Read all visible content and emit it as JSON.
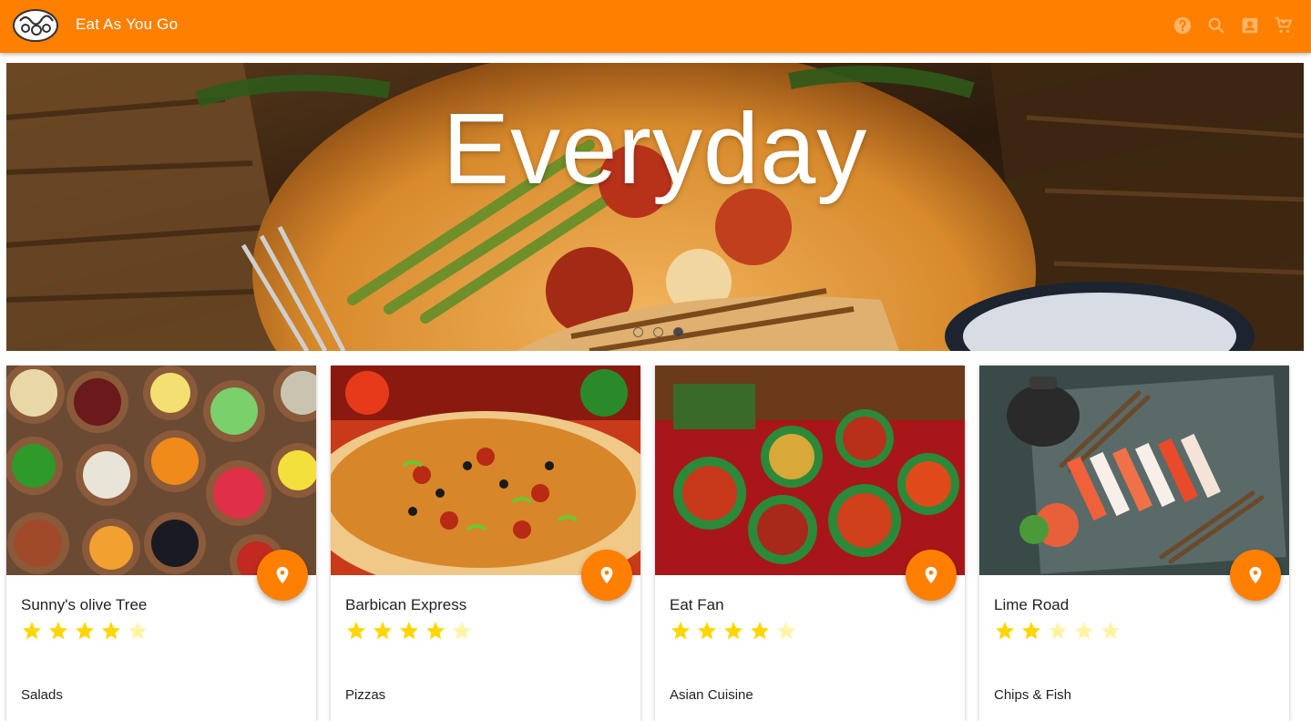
{
  "app": {
    "title": "Eat As You Go"
  },
  "toolbar": {
    "icons": [
      "help-icon",
      "search-icon",
      "account-box-icon",
      "cart-icon"
    ]
  },
  "hero": {
    "caption": "Everyday",
    "slides": 3,
    "active_slide": 3
  },
  "restaurants": [
    {
      "name": "Sunny's olive Tree",
      "rating": 4.5,
      "category": "Salads"
    },
    {
      "name": "Barbican Express",
      "rating": 4.5,
      "category": "Pizzas"
    },
    {
      "name": "Eat Fan",
      "rating": 4.5,
      "category": "Asian Cuisine"
    },
    {
      "name": "Lime Road",
      "rating": 2,
      "category": "Chips & Fish"
    }
  ],
  "colors": {
    "accent": "#ff7f00",
    "star_on": "#ffd600",
    "star_off": "#fff3a6"
  }
}
